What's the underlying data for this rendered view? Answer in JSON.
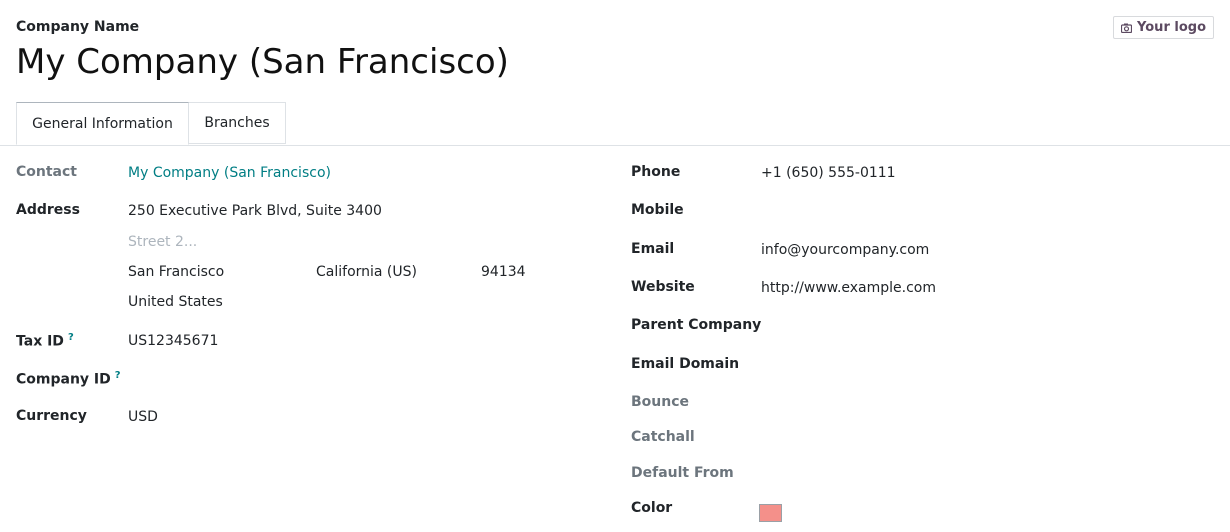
{
  "header": {
    "company_label": "Company Name",
    "company_name": "My Company (San Francisco)",
    "logo_button": "Your logo"
  },
  "tabs": [
    {
      "label": "General Information",
      "active": true
    },
    {
      "label": "Branches",
      "active": false
    }
  ],
  "left": {
    "contact_label": "Contact",
    "contact_value": "My Company (San Francisco)",
    "address_label": "Address",
    "street": "250 Executive Park Blvd, Suite 3400",
    "street2_placeholder": "Street 2...",
    "city": "San Francisco",
    "state": "California (US)",
    "zip": "94134",
    "country": "United States",
    "tax_id_label": "Tax ID",
    "tax_id_value": "US12345671",
    "company_id_label": "Company ID",
    "help_mark": "?",
    "currency_label": "Currency",
    "currency_value": "USD"
  },
  "right": {
    "phone_label": "Phone",
    "phone_value": "+1 (650) 555-0111",
    "mobile_label": "Mobile",
    "email_label": "Email",
    "email_value": "info@yourcompany.com",
    "website_label": "Website",
    "website_value": "http://www.example.com",
    "parent_company_label": "Parent Company",
    "email_domain_label": "Email Domain",
    "bounce_label": "Bounce",
    "catchall_label": "Catchall",
    "default_from_label": "Default From",
    "color_label": "Color",
    "color_value": "#f4908a"
  },
  "colors": {
    "link": "#017e84",
    "logo_text": "#5c4a61"
  },
  "icons": {
    "logo": "camera-icon"
  }
}
